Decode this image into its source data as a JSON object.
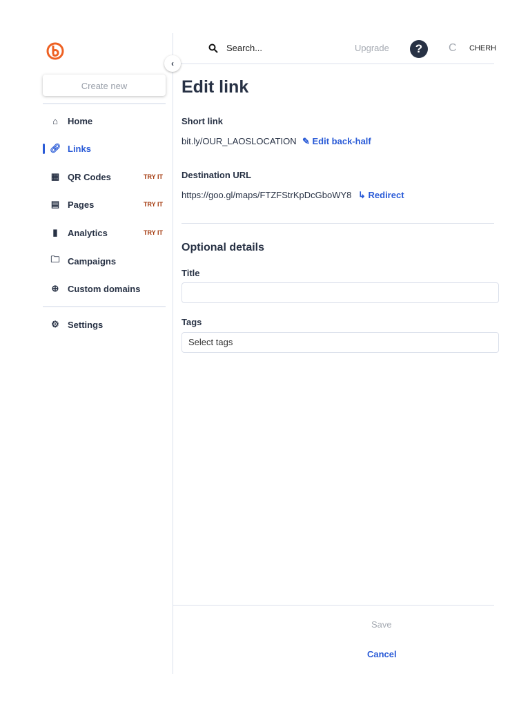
{
  "sidebar": {
    "create_new": "Create new",
    "items": [
      {
        "label": "Home",
        "icon": "home-icon"
      },
      {
        "label": "Links",
        "icon": "link-icon"
      },
      {
        "label": "QR Codes",
        "icon": "qr-code-icon",
        "badge": "TRY IT"
      },
      {
        "label": "Pages",
        "icon": "page-icon",
        "badge": "TRY IT"
      },
      {
        "label": "Analytics",
        "icon": "bar-chart-icon",
        "badge": "TRY IT"
      },
      {
        "label": "Campaigns",
        "icon": "folder-icon"
      },
      {
        "label": "Custom domains",
        "icon": "globe-icon"
      },
      {
        "label": "Settings",
        "icon": "gear-icon"
      }
    ]
  },
  "topbar": {
    "search_placeholder": "Search...",
    "upgrade": "Upgrade",
    "avatar_initial": "C",
    "user": "CHERH"
  },
  "main": {
    "title": "Edit link",
    "short_link_label": "Short link",
    "short_link": "bit.ly/OUR_LAOSLOCATION",
    "edit_back_half": "Edit back-half",
    "destination_label": "Destination URL",
    "destination": "https://goo.gl/maps/FTZFStrKpDcGboWY8",
    "redirect": "Redirect",
    "optional": "Optional details",
    "title_label": "Title",
    "title_value": "",
    "tags_label": "Tags",
    "tags_placeholder": "Select tags"
  },
  "footer": {
    "save": "Save",
    "cancel": "Cancel"
  },
  "colors": {
    "accent": "#2a5bd7",
    "brand": "#ee6123",
    "badge": "#a43a0e"
  }
}
